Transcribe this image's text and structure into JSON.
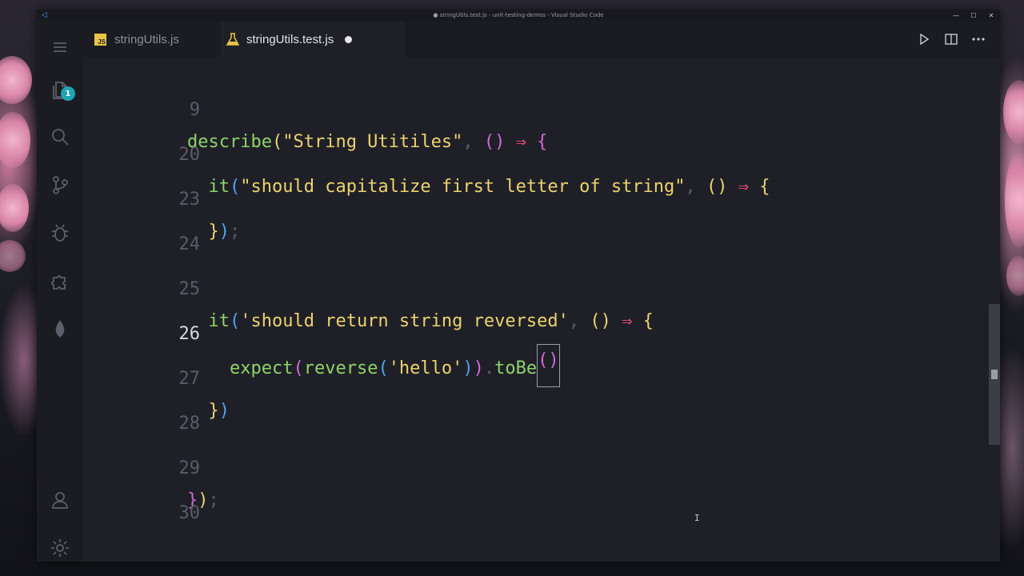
{
  "window": {
    "title": "● stringUtils.test.js - unit-testing-demos - Visual Studio Code"
  },
  "activity_bar": {
    "items": [
      "files-icon",
      "search-icon",
      "source-control-icon",
      "debug-icon",
      "extensions-icon",
      "mongodb-icon"
    ],
    "explorer_badge": "1",
    "bottom_items": [
      "account-icon",
      "settings-icon"
    ]
  },
  "tabs": [
    {
      "label": "stringUtils.js",
      "icon": "js-file-icon",
      "active": false
    },
    {
      "label": "stringUtils.test.js",
      "icon": "flask-icon",
      "active": true,
      "dirty": true
    }
  ],
  "editor": {
    "lines": [
      {
        "number": "9"
      },
      {
        "number": "20"
      },
      {
        "number": "23"
      },
      {
        "number": "24"
      },
      {
        "number": "25"
      },
      {
        "number": "26",
        "active": true
      },
      {
        "number": "27"
      },
      {
        "number": "28"
      },
      {
        "number": "29"
      },
      {
        "number": "30"
      }
    ],
    "tokens": {
      "describe": "describe",
      "describe_str": "\"String Utitiles\"",
      "it": "it",
      "it1_str": "\"should capitalize first letter of string\"",
      "it2_str": "'should return string reversed'",
      "expect": "expect",
      "reverse": "reverse",
      "hello": "'hello'",
      "toBe": "toBe",
      "arrow": "⇒"
    }
  },
  "colors": {
    "keyword": "#8ed36a",
    "string": "#ecd36f",
    "arrow": "#ee4e78",
    "bracket_pink": "#d06ad6",
    "bracket_blue": "#4da3f0",
    "badge": "#1fa3b1"
  }
}
